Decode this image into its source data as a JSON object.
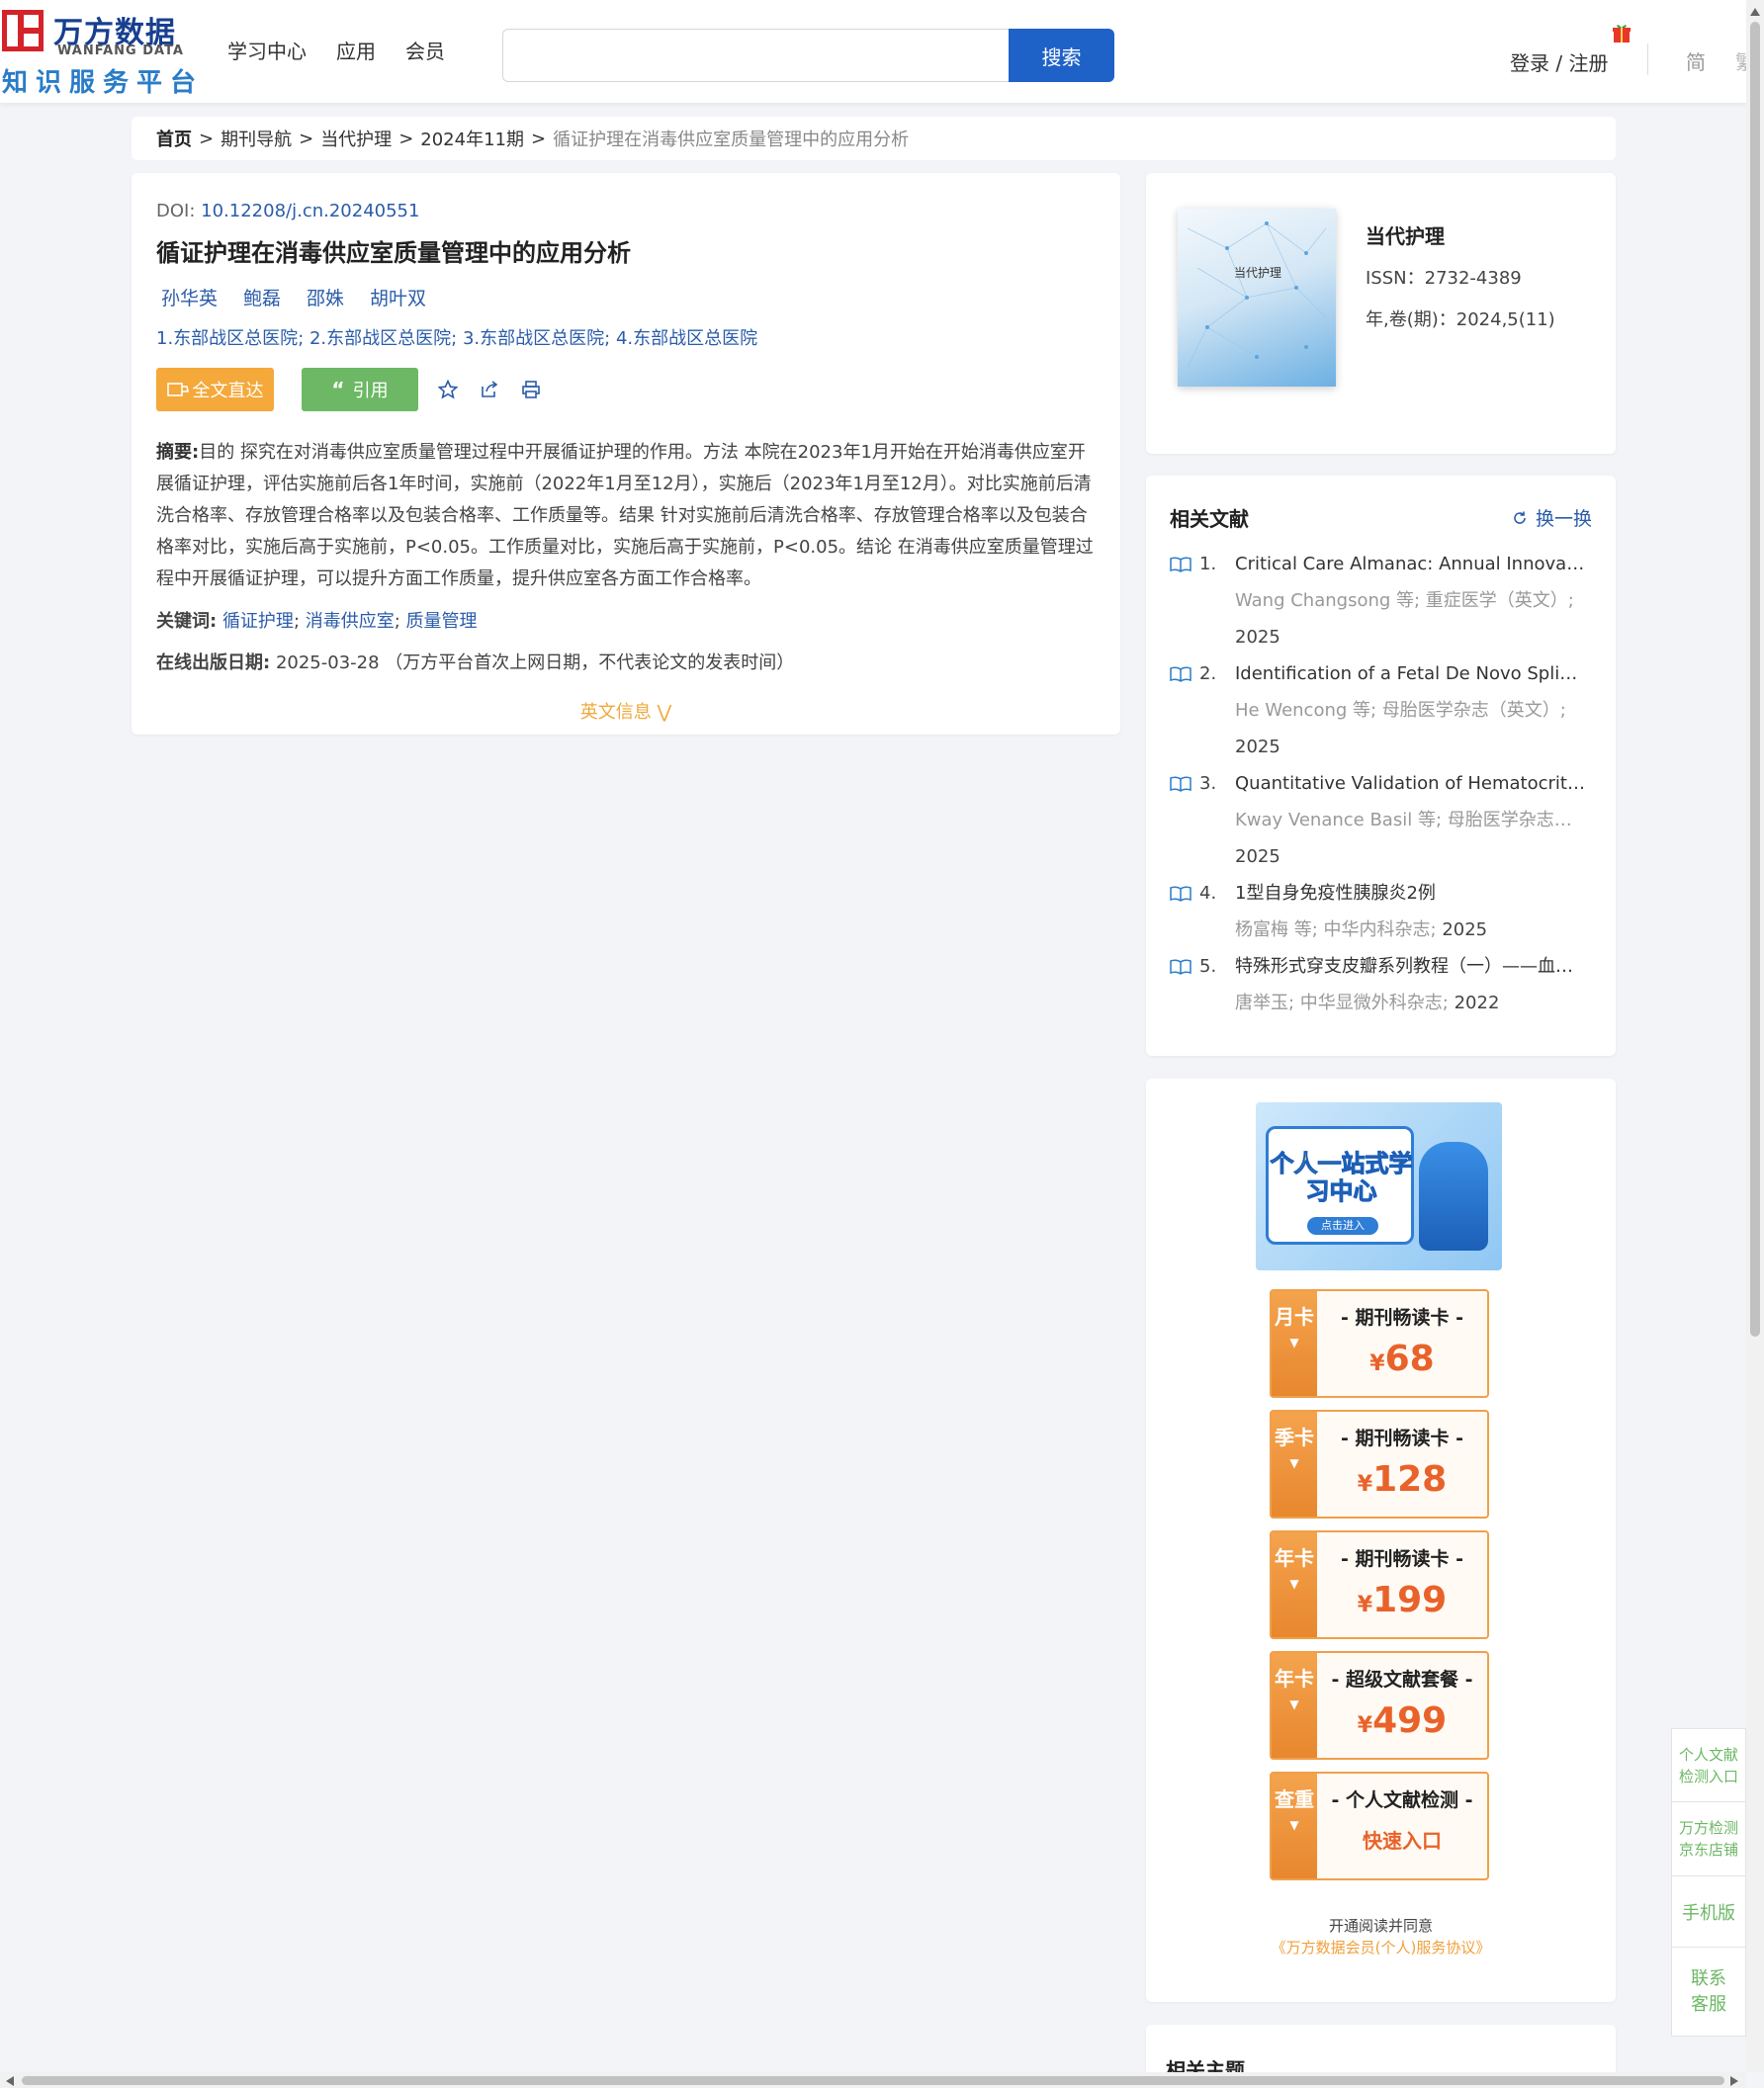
{
  "header": {
    "logo_cn": "万方数据",
    "logo_en": "WANFANG DATA",
    "logo_sub": "知识服务平台",
    "nav": [
      "学习中心",
      "应用",
      "会员"
    ],
    "search_placeholder": "",
    "search_button": "搜索",
    "login": "登录 / 注册",
    "lang_simplified": "简",
    "lang_traditional": "繁"
  },
  "breadcrumb": {
    "home": "首页",
    "items": [
      "期刊导航",
      "当代护理",
      "2024年11期"
    ],
    "current": "循证护理在消毒供应室质量管理中的应用分析"
  },
  "article": {
    "doi_label": "DOI:",
    "doi": "10.12208/j.cn.20240551",
    "title": "循证护理在消毒供应室质量管理中的应用分析",
    "authors": [
      "孙华英",
      "鲍磊",
      "邵姝",
      "胡叶双"
    ],
    "orgs": [
      {
        "num": "1.",
        "name": "东部战区总医院"
      },
      {
        "num": "2.",
        "name": "东部战区总医院"
      },
      {
        "num": "3.",
        "name": "东部战区总医院"
      },
      {
        "num": "4.",
        "name": "东部战区总医院"
      }
    ],
    "btn_fulltext": "全文直达",
    "btn_cite": "引用",
    "abstract_label": "摘要:",
    "abstract": "目的 探究在对消毒供应室质量管理过程中开展循证护理的作用。方法 本院在2023年1月开始在开始消毒供应室开展循证护理，评估实施前后各1年时间，实施前（2022年1月至12月），实施后（2023年1月至12月）。对比实施前后清洗合格率、存放管理合格率以及包装合格率、工作质量等。结果 针对实施前后清洗合格率、存放管理合格率以及包装合格率对比，实施后高于实施前，P<0.05。工作质量对比，实施后高于实施前，P<0.05。结论 在消毒供应室质量管理过程中开展循证护理，可以提升方面工作质量，提升供应室各方面工作合格率。",
    "keywords_label": "关键词:",
    "keywords": [
      "循证护理",
      "消毒供应室",
      "质量管理"
    ],
    "pubdate_label": "在线出版日期:",
    "pubdate": "2025-03-28",
    "pubdate_note": "（万方平台首次上网日期，不代表论文的发表时间）",
    "en_info": "英文信息"
  },
  "journal": {
    "cover_title": "当代护理",
    "name": "当代护理",
    "issn": "ISSN：2732-4389",
    "volume": "年,卷(期)：2024,5(11)"
  },
  "related": {
    "title": "相关文献",
    "refresh": "换一换",
    "items": [
      {
        "num": "1.",
        "title": "Critical Care Almanac: Annual Innovations in Critical Care",
        "meta": "Wang Changsong 等; 重症医学（英文）;",
        "year": "2025"
      },
      {
        "num": "2.",
        "title": "Identification of a Fetal De Novo Splice Variant",
        "meta": "He Wencong 等; 母胎医学杂志（英文）;",
        "year": "2025"
      },
      {
        "num": "3.",
        "title": "Quantitative Validation of Hematocrit Percentage",
        "meta": "Kway Venance Basil 等; 母胎医学杂志（英文）;",
        "year": "2025"
      },
      {
        "num": "4.",
        "title": "1型自身免疫性胰腺炎2例",
        "meta": "杨富梅 等; 中华内科杂志;",
        "year": "2025"
      },
      {
        "num": "5.",
        "title": "特殊形式穿支皮瓣系列教程（一）——血流桥接",
        "meta": "唐举玉; 中华显微外科杂志;",
        "year": "2022"
      }
    ]
  },
  "promo": {
    "banner_text": "个人一站式学习中心",
    "banner_btn": "点击进入",
    "plans": [
      {
        "tag": "月卡",
        "name": "- 期刊畅读卡 -",
        "currency": "¥",
        "price": "68"
      },
      {
        "tag": "季卡",
        "name": "- 期刊畅读卡 -",
        "currency": "¥",
        "price": "128"
      },
      {
        "tag": "年卡",
        "name": "- 期刊畅读卡 -",
        "currency": "¥",
        "price": "199"
      },
      {
        "tag": "年卡",
        "name": "- 超级文献套餐 -",
        "currency": "¥",
        "price": "499"
      },
      {
        "tag": "查重",
        "name": "- 个人文献检测 -",
        "fast": "快速入口"
      }
    ],
    "agree_line1": "开通阅读并同意",
    "agree_line2": "《万方数据会员(个人)服务协议》"
  },
  "topics": {
    "title": "相关主题"
  },
  "float_bar": [
    "个人文献检测入口",
    "万方检测京东店铺",
    "手机版",
    "联系客服"
  ],
  "colors": {
    "primary_blue": "#1e62c8",
    "link_blue": "#2a5caa",
    "orange": "#f4a93a",
    "green": "#6cb865",
    "price_orange": "#e8622a"
  }
}
